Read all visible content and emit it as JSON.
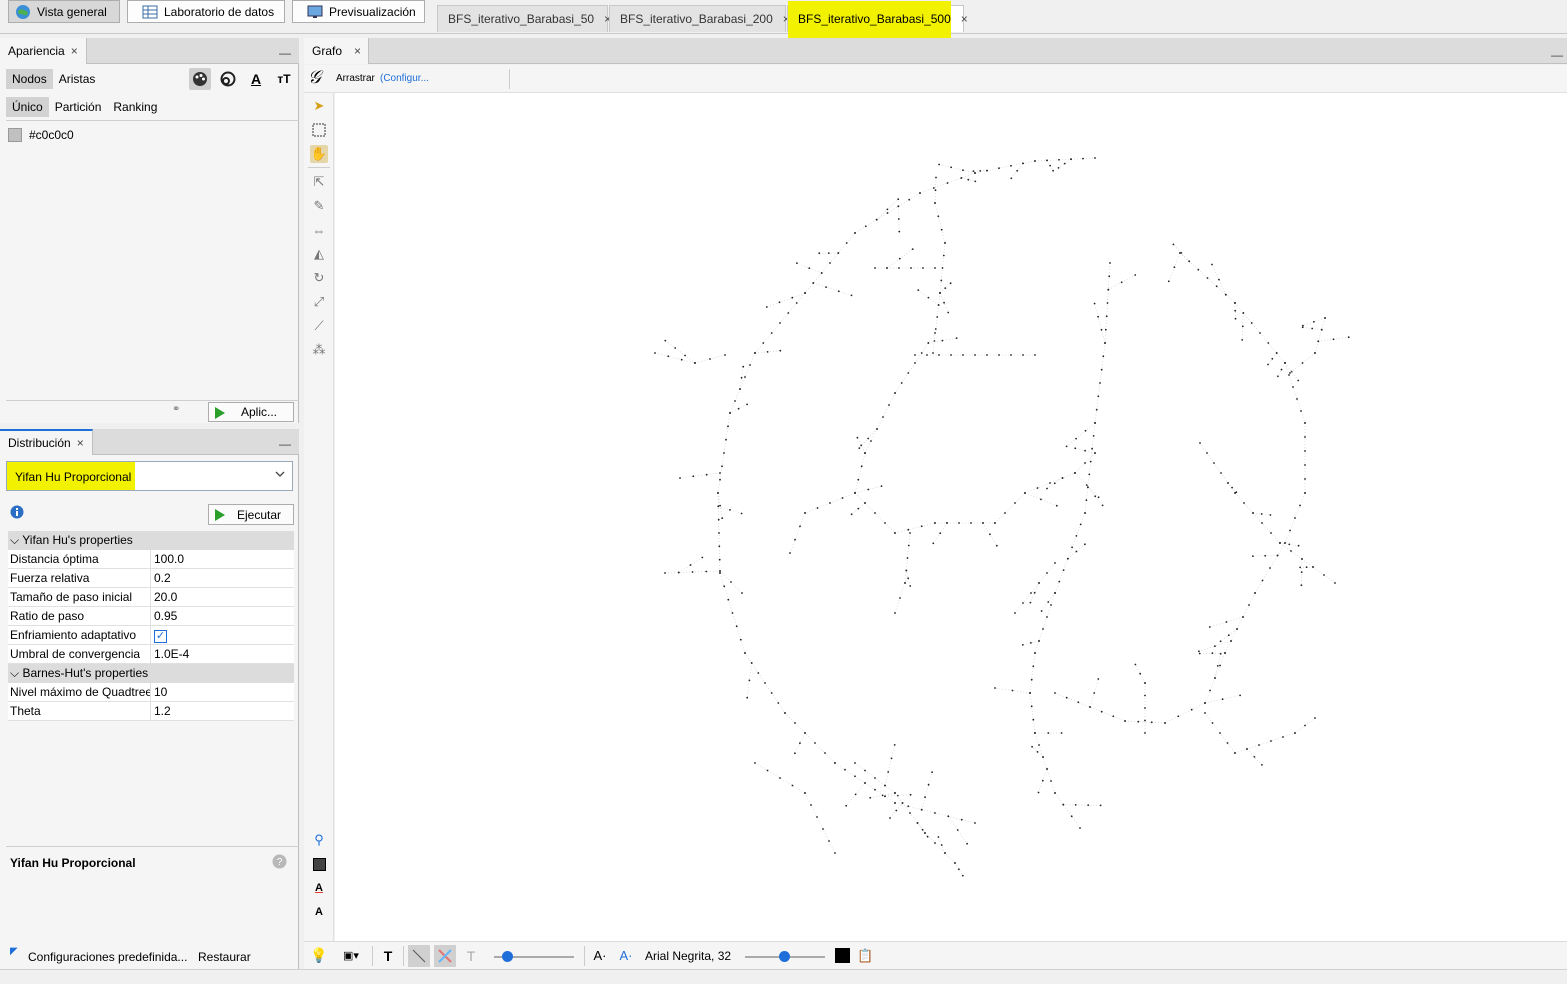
{
  "top_tabs": {
    "overview": "Vista general",
    "datalab": "Laboratorio de datos",
    "preview": "Previsualización"
  },
  "documents": [
    {
      "label": "BFS_iterativo_Barabasi_50"
    },
    {
      "label": "BFS_iterativo_Barabasi_200"
    },
    {
      "label": "BFS_iterativo_Barabasi_500"
    }
  ],
  "close_glyph": "×",
  "appearance": {
    "title": "Apariencia",
    "element_tabs": [
      "Nodos",
      "Aristas"
    ],
    "mode_tabs": [
      "Único",
      "Partición",
      "Ranking"
    ],
    "color_value": "#c0c0c0",
    "apply_button": "Aplic..."
  },
  "layout": {
    "title": "Distribución",
    "algorithm": "Yifan Hu Proporcional",
    "run_button": "Ejecutar",
    "groups": [
      {
        "name": "Yifan Hu's properties",
        "rows": [
          {
            "k": "Distancia óptima",
            "v": "100.0"
          },
          {
            "k": "Fuerza relativa",
            "v": "0.2"
          },
          {
            "k": "Tamaño de paso inicial",
            "v": "20.0"
          },
          {
            "k": "Ratio de paso",
            "v": "0.95"
          },
          {
            "k": "Enfriamiento adaptativo",
            "v": "✓"
          },
          {
            "k": "Umbral de convergencia",
            "v": "1.0E-4"
          }
        ]
      },
      {
        "name": "Barnes-Hut's properties",
        "rows": [
          {
            "k": "Nivel máximo de Quadtree",
            "v": "10"
          },
          {
            "k": "Theta",
            "v": "1.2"
          }
        ]
      }
    ],
    "description_title": "Yifan Hu Proporcional",
    "presets": "Configuraciones predefinida...",
    "restore": "Restaurar"
  },
  "graph": {
    "title": "Grafo",
    "drag_label": "Arrastrar",
    "config_link": "(Configur...",
    "font_label": "Arial Negrita, 32"
  },
  "colors": {
    "highlight": "#f2f200",
    "accent": "#1e6fd9"
  }
}
